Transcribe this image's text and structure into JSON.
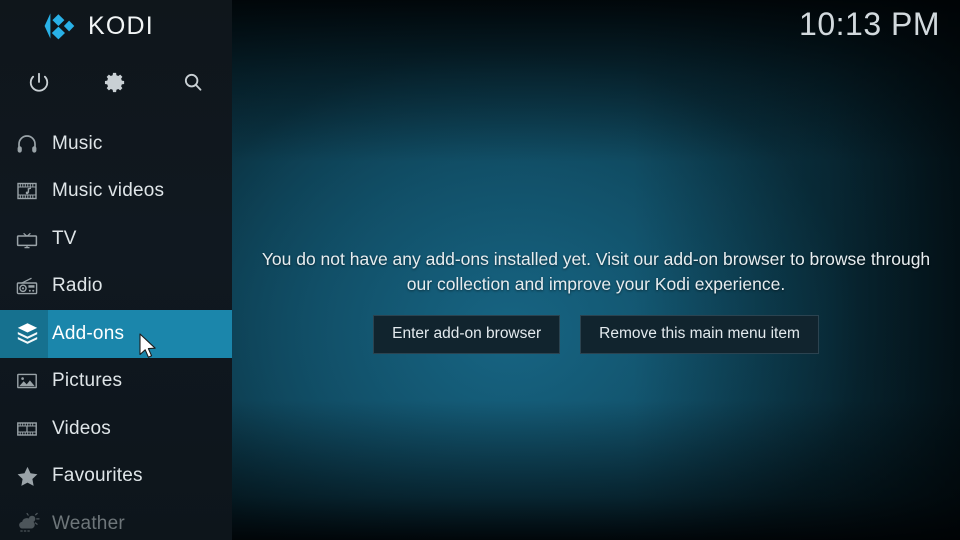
{
  "brand": {
    "name": "KODI",
    "logo_icon": "kodi-logo-icon"
  },
  "clock": {
    "time": "10:13 PM"
  },
  "top_actions": [
    {
      "name": "power",
      "icon": "power-icon",
      "label": "Power"
    },
    {
      "name": "settings",
      "icon": "gear-icon",
      "label": "Settings"
    },
    {
      "name": "search",
      "icon": "search-icon",
      "label": "Search"
    }
  ],
  "sidebar": {
    "items": [
      {
        "label": "Music",
        "icon": "headphones-icon",
        "selected": false,
        "dimmed": false
      },
      {
        "label": "Music videos",
        "icon": "music-video-icon",
        "selected": false,
        "dimmed": false
      },
      {
        "label": "TV",
        "icon": "tv-icon",
        "selected": false,
        "dimmed": false
      },
      {
        "label": "Radio",
        "icon": "radio-icon",
        "selected": false,
        "dimmed": false
      },
      {
        "label": "Add-ons",
        "icon": "addons-box-icon",
        "selected": true,
        "dimmed": false
      },
      {
        "label": "Pictures",
        "icon": "pictures-icon",
        "selected": false,
        "dimmed": false
      },
      {
        "label": "Videos",
        "icon": "film-strip-icon",
        "selected": false,
        "dimmed": false
      },
      {
        "label": "Favourites",
        "icon": "star-icon",
        "selected": false,
        "dimmed": false
      },
      {
        "label": "Weather",
        "icon": "weather-icon",
        "selected": false,
        "dimmed": true
      }
    ]
  },
  "main": {
    "message": "You do not have any add-ons installed yet. Visit our add-on browser to browse through our collection and improve your Kodi experience.",
    "buttons": [
      {
        "label": "Enter add-on browser"
      },
      {
        "label": "Remove this main menu item"
      }
    ]
  },
  "colors": {
    "accent": "#1b86ab",
    "accent_dark": "#16718f",
    "sidebar_bg": "#101820",
    "logo_blue": "#28b0e6",
    "text": "#dfe5e8",
    "button_bg": "#11242e"
  }
}
